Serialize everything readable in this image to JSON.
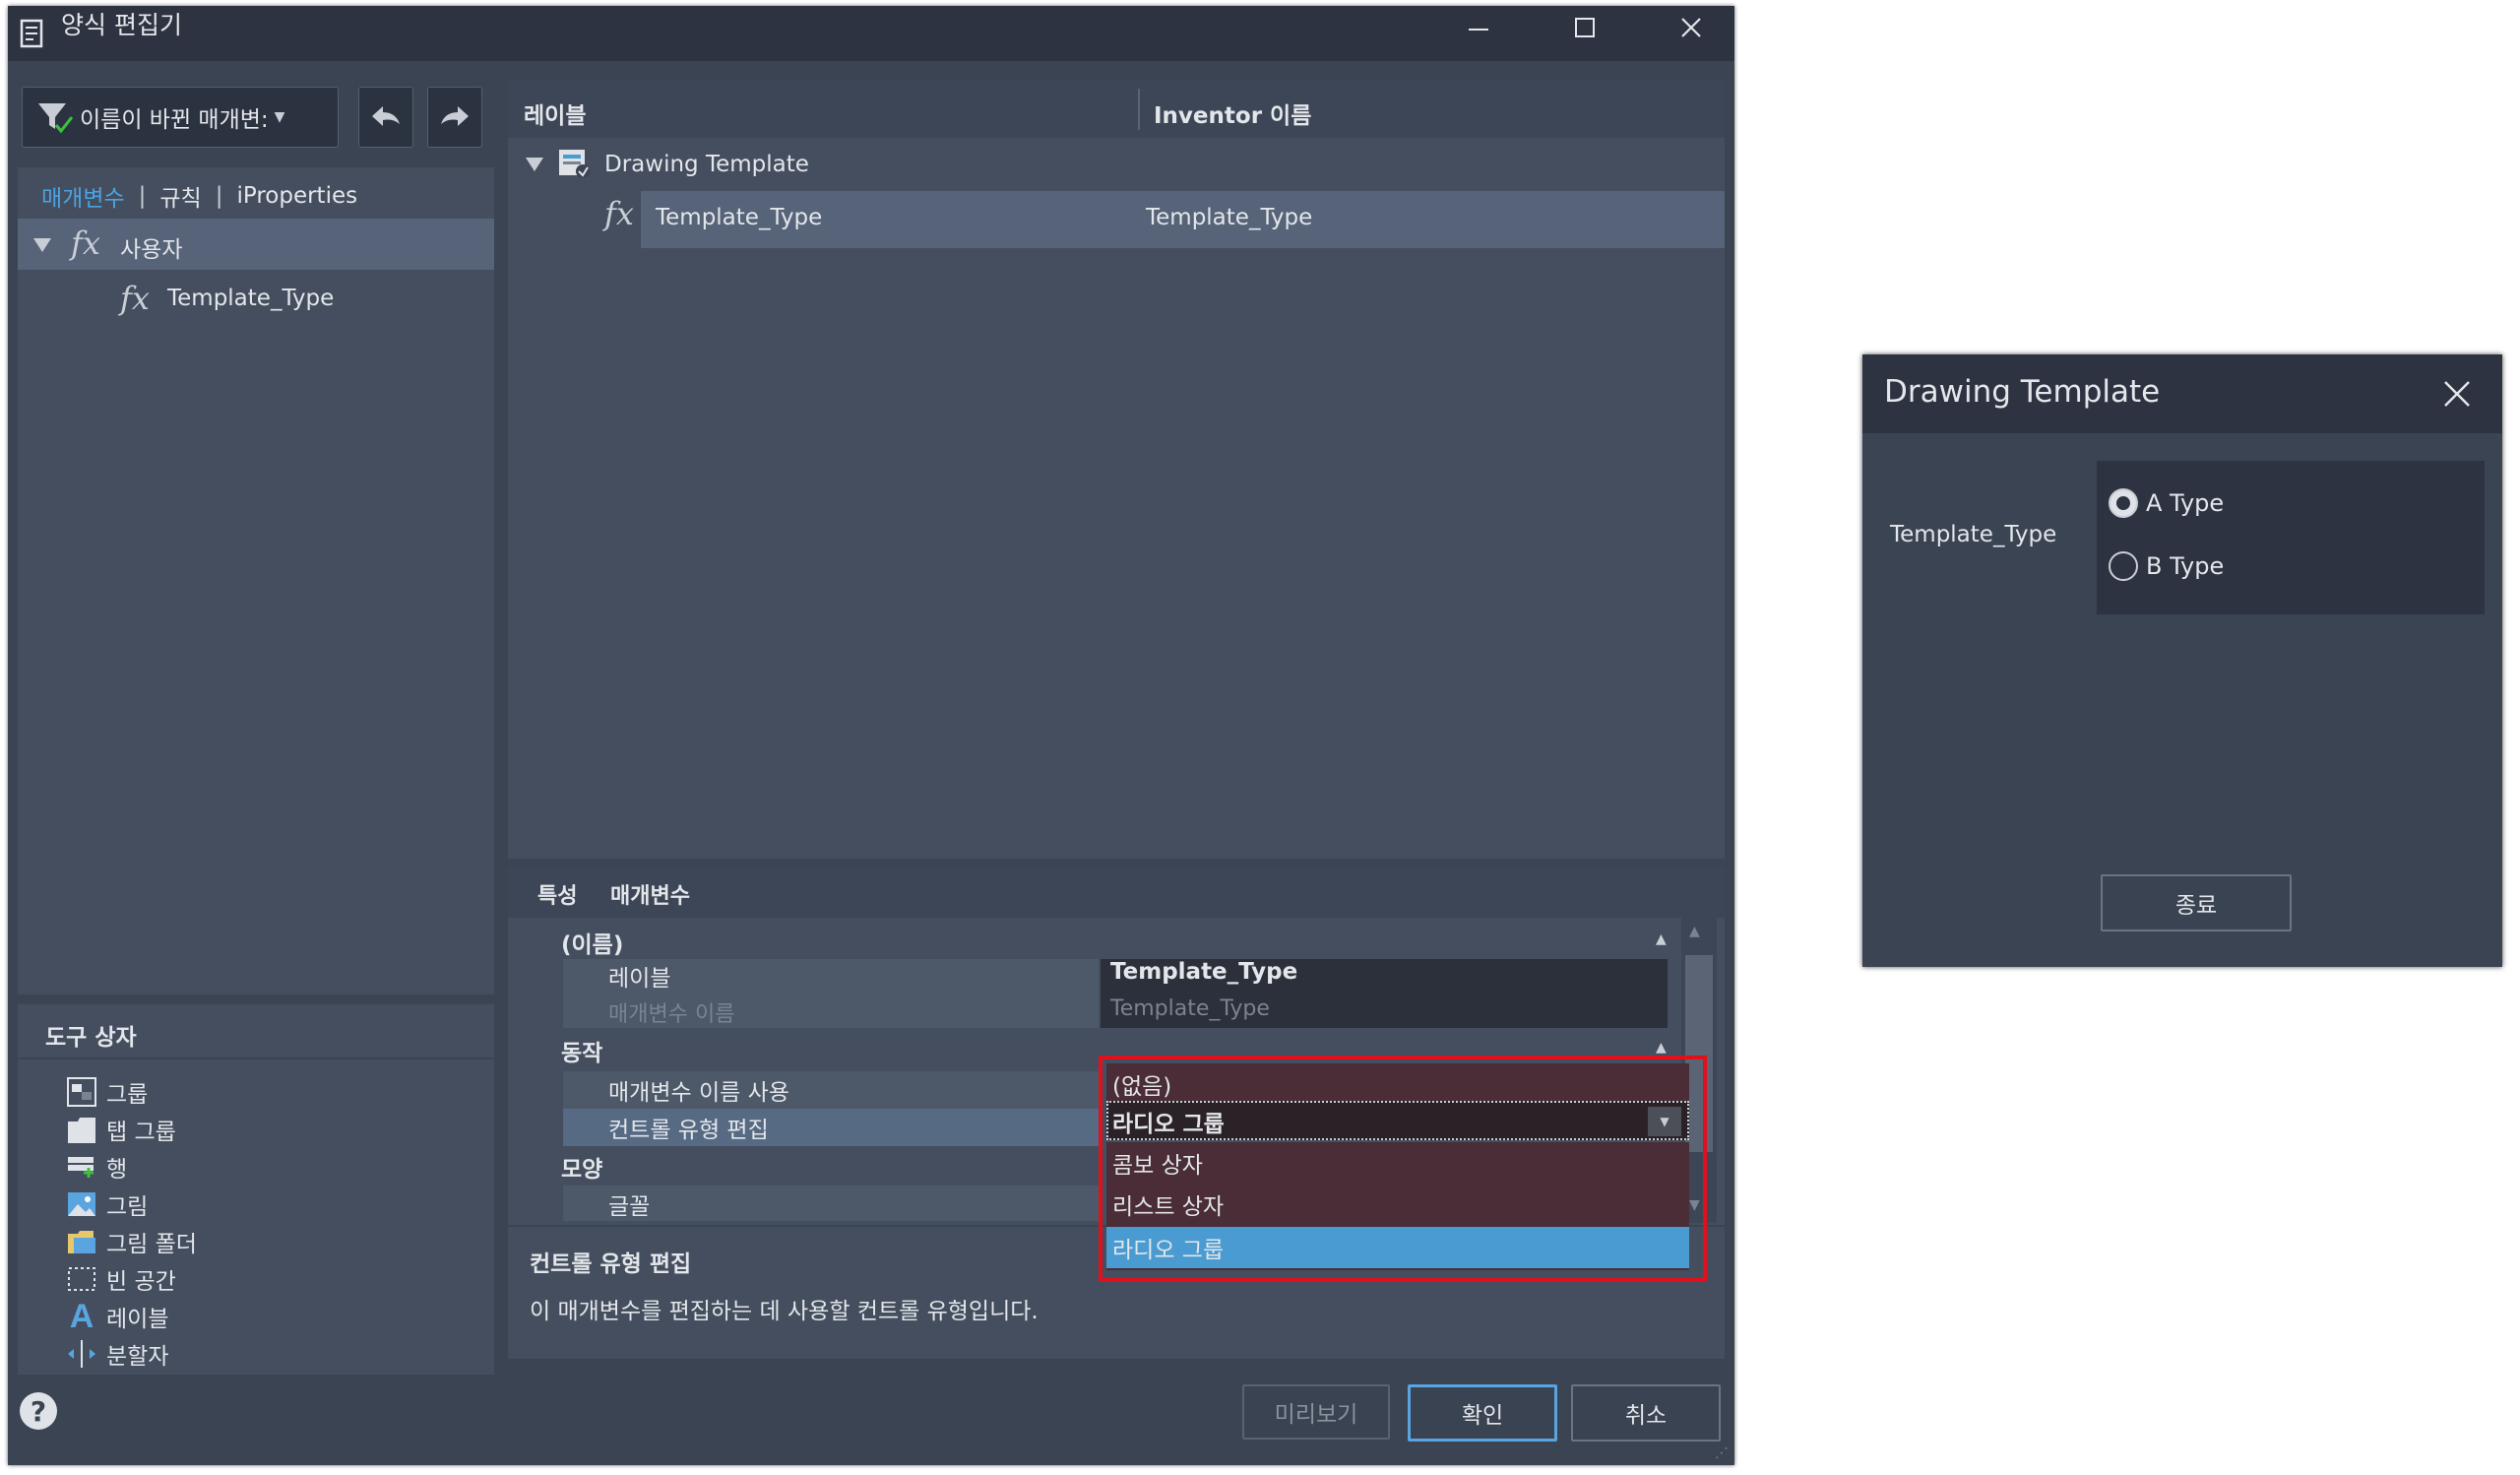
{
  "window": {
    "title": "양식 편집기",
    "controls": [
      "minimize",
      "maximize",
      "close"
    ]
  },
  "toolbar": {
    "filter_label": "이름이 바뀐 매개변:"
  },
  "left_tabs": [
    "매개변수",
    "규칙",
    "iProperties"
  ],
  "tree_left": {
    "group_label": "사용자",
    "item_label": "Template_Type"
  },
  "toolbox": {
    "title": "도구 상자",
    "items": [
      "그룹",
      "탭 그룹",
      "행",
      "그림",
      "그림 폴더",
      "빈 공간",
      "레이블",
      "분할자"
    ]
  },
  "grid": {
    "headers": [
      "레이블",
      "Inventor 이름"
    ],
    "root_label": "Drawing Template",
    "row": {
      "label": "Template_Type",
      "inventor_name": "Template_Type"
    }
  },
  "properties": {
    "tabs": [
      "특성",
      "매개변수"
    ],
    "section_name": "(이름)",
    "label_key": "레이블",
    "label_value": "Template_Type",
    "param_key": "매개변수 이름",
    "param_value": "Template_Type",
    "section_behavior": "동작",
    "use_param_name_key": "매개변수 이름 사용",
    "edit_control_key": "컨트롤 유형 편집",
    "section_appearance": "모양",
    "font_key": "글꼴",
    "dropdown": {
      "above_value": "(없음)",
      "selected": "라디오 그룹",
      "options": [
        "콤보 상자",
        "리스트 상자",
        "라디오 그룹"
      ],
      "highlighted_index": 2
    },
    "description_title": "컨트롤 유형 편집",
    "description_text": "이 매개변수를 편집하는 데 사용할 컨트롤 유형입니다."
  },
  "footer": {
    "help": "?",
    "preview": "미리보기",
    "ok": "확인",
    "cancel": "취소"
  },
  "colors": {
    "highlight_outline": "#e0101d",
    "selection_blue": "#4a9bd1",
    "dropdown_bg": "#4a2d37"
  },
  "preview_dialog": {
    "title": "Drawing Template",
    "field_label": "Template_Type",
    "options": [
      "A Type",
      "B Type"
    ],
    "selected_index": 0,
    "close_button": "종료"
  }
}
